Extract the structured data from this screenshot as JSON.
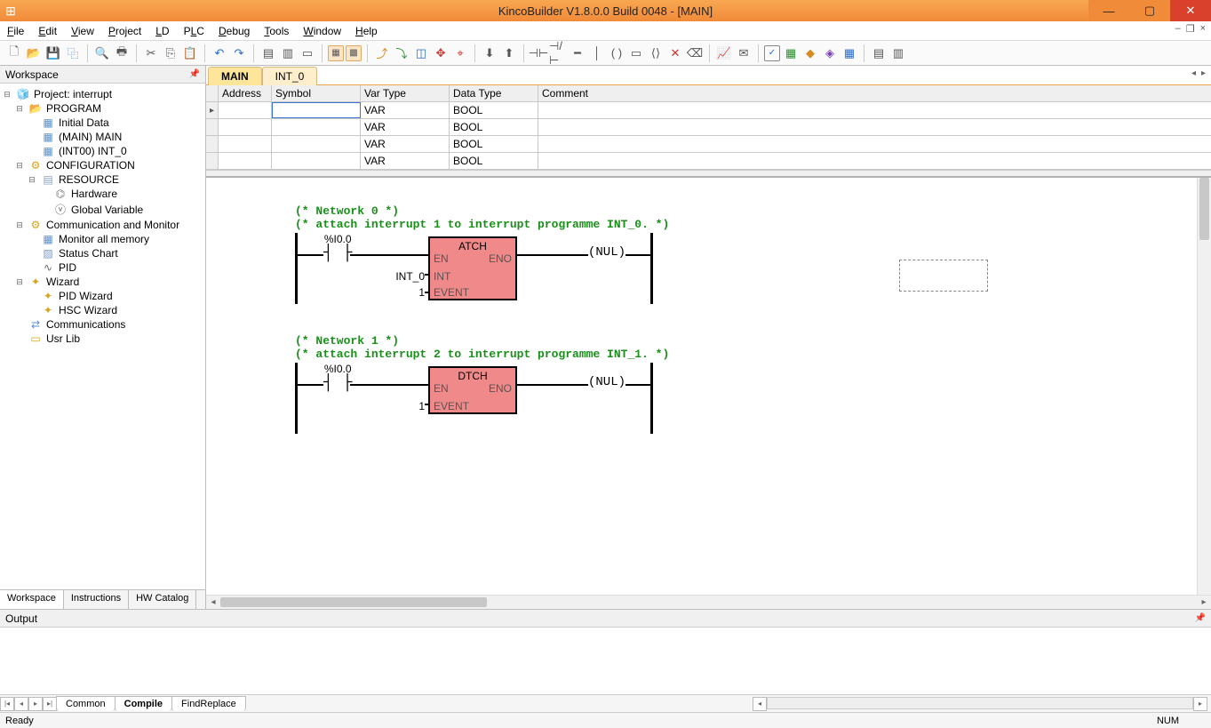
{
  "window": {
    "title": "KincoBuilder V1.8.0.0 Build 0048 - [MAIN]"
  },
  "menus": [
    "File",
    "Edit",
    "View",
    "Project",
    "LD",
    "PLC",
    "Debug",
    "Tools",
    "Window",
    "Help"
  ],
  "workspace": {
    "title": "Workspace",
    "tabs": [
      "Workspace",
      "Instructions",
      "HW Catalog"
    ],
    "tree": {
      "root": "Project: interrupt",
      "program": "PROGRAM",
      "initial_data": "Initial Data",
      "main": "(MAIN)  MAIN",
      "int0": "(INT00)  INT_0",
      "configuration": "CONFIGURATION",
      "resource": "RESOURCE",
      "hardware": "Hardware",
      "global_var": "Global Variable",
      "comm_mon": "Communication and Monitor",
      "mon_all": "Monitor all memory",
      "status_chart": "Status Chart",
      "pid": "PID",
      "wizard": "Wizard",
      "pid_wiz": "PID Wizard",
      "hsc_wiz": "HSC Wizard",
      "communications": "Communications",
      "usr_lib": "Usr Lib"
    }
  },
  "doc_tabs": [
    "MAIN",
    "INT_0"
  ],
  "grid": {
    "headers": [
      "Address",
      "Symbol",
      "Var Type",
      "Data Type",
      "Comment"
    ],
    "rows": [
      {
        "addr": "",
        "sym": "",
        "vt": "VAR",
        "dt": "BOOL",
        "cmt": ""
      },
      {
        "addr": "",
        "sym": "",
        "vt": "VAR",
        "dt": "BOOL",
        "cmt": ""
      },
      {
        "addr": "",
        "sym": "",
        "vt": "VAR",
        "dt": "BOOL",
        "cmt": ""
      },
      {
        "addr": "",
        "sym": "",
        "vt": "VAR",
        "dt": "BOOL",
        "cmt": ""
      }
    ]
  },
  "ladder": {
    "net0": {
      "title": "(* Network 0 *)",
      "cmt": "(* attach interrupt 1 to interrupt programme INT_0. *)",
      "contact": "%I0.0",
      "block": "ATCH",
      "en": "EN",
      "eno": "ENO",
      "int_lbl": "INT",
      "int_val": "INT_0",
      "evt_lbl": "EVENT",
      "evt_val": "1",
      "coil": "(NUL)"
    },
    "net1": {
      "title": "(* Network 1 *)",
      "cmt": "(* attach interrupt 2 to interrupt programme INT_1. *)",
      "contact": "%I0.0",
      "block": "DTCH",
      "en": "EN",
      "eno": "ENO",
      "evt_lbl": "EVENT",
      "evt_val": "1",
      "coil": "(NUL)"
    }
  },
  "output": {
    "title": "Output",
    "tabs": [
      "Common",
      "Compile",
      "FindReplace"
    ]
  },
  "status": {
    "ready": "Ready",
    "num": "NUM"
  }
}
